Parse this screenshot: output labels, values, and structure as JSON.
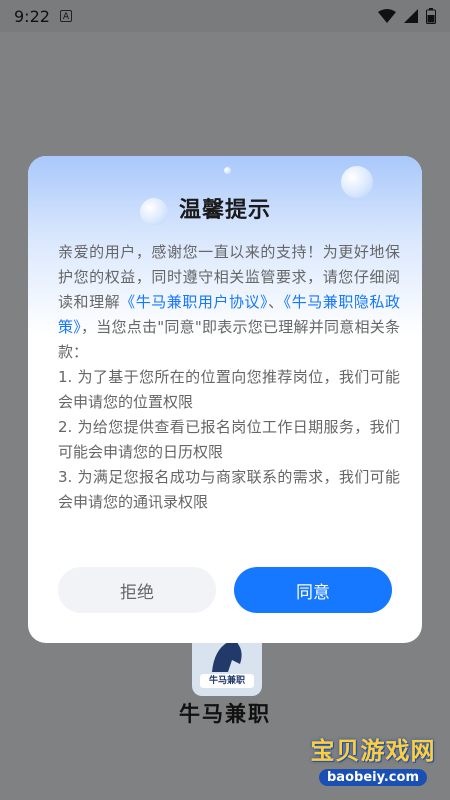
{
  "status_bar": {
    "time": "9:22",
    "notification_icon": "A"
  },
  "app": {
    "logo_text": "牛马兼职",
    "name": "牛马兼职"
  },
  "watermark": {
    "main": "宝贝游戏网",
    "url": "baobeiy.com"
  },
  "dialog": {
    "title": "温馨提示",
    "intro_before": "亲爱的用户，感谢您一直以来的支持！为更好地保护您的权益，同时遵守相关监管要求，请您仔细阅读和理解",
    "link_user_agreement": "《牛马兼职用户协议》",
    "separator": "、",
    "link_privacy_policy": "《牛马兼职隐私政策》",
    "intro_after": "，当您点击\"同意\"即表示您已理解并同意相关条款：",
    "items": [
      "1. 为了基于您所在的位置向您推荐岗位，我们可能会申请您的位置权限",
      "2. 为给您提供查看已报名岗位工作日期服务，我们可能会申请您的日历权限",
      "3. 为满足您报名成功与商家联系的需求，我们可能会申请您的通讯录权限"
    ],
    "decline_label": "拒绝",
    "agree_label": "同意"
  },
  "colors": {
    "accent": "#1677ff",
    "overlay": "#808182"
  }
}
